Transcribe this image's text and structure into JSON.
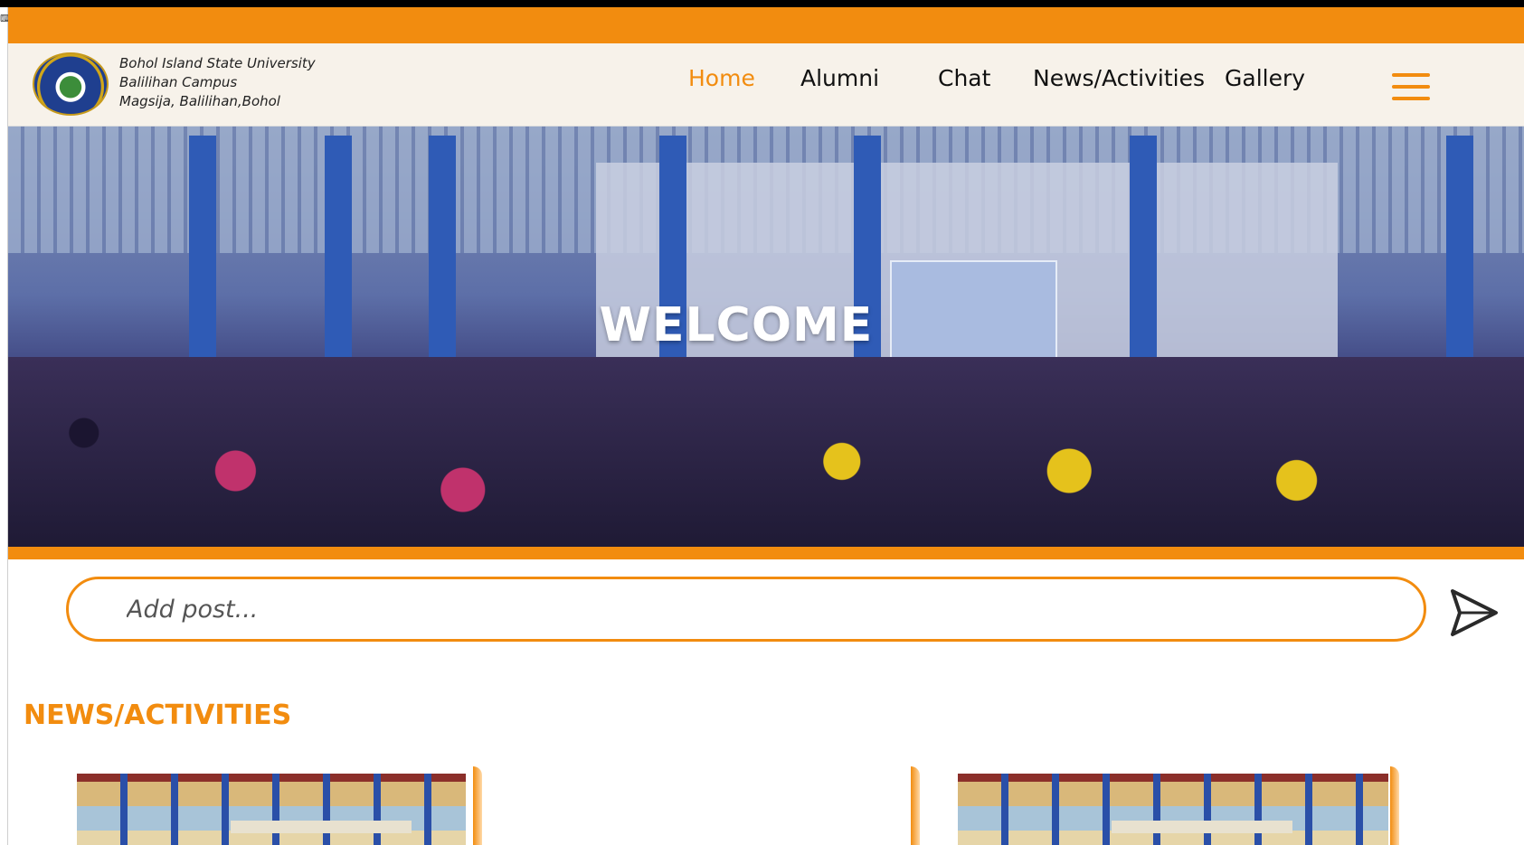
{
  "colors": {
    "accent": "#f28c0f",
    "nav_bg": "#f7f2ea",
    "text": "#111111"
  },
  "header": {
    "university_lines": [
      "Bohol Island State University",
      "Balilihan Campus",
      "Magsija, Balilihan,Bohol"
    ]
  },
  "nav": {
    "items": [
      {
        "label": "Home",
        "active": true
      },
      {
        "label": "Alumni",
        "active": false
      },
      {
        "label": "Chat",
        "active": false
      },
      {
        "label": "News/Activities",
        "active": false
      },
      {
        "label": "Gallery",
        "active": false
      }
    ],
    "menu_icon": "hamburger-icon"
  },
  "hero": {
    "title": "WELCOME"
  },
  "composer": {
    "placeholder": "Add post...",
    "send_icon": "send-icon"
  },
  "news": {
    "title": "NEWS/ACTIVITIES"
  }
}
